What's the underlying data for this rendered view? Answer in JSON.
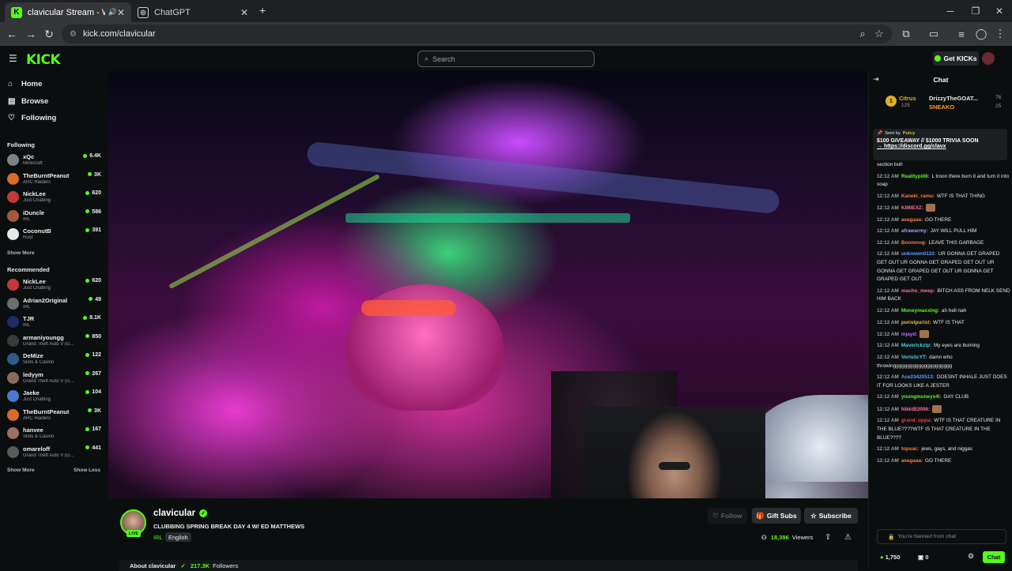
{
  "browser": {
    "tabs": [
      {
        "title": "clavicular Stream - Watch L",
        "active": true
      },
      {
        "title": "ChatGPT",
        "active": false
      }
    ],
    "url": "kick.com/clavicular"
  },
  "header": {
    "logo": "KICK",
    "search_placeholder": "Search",
    "get_kicks_label": "Get KICKs"
  },
  "sidebar": {
    "nav": [
      {
        "label": "Home",
        "icon": "home-icon"
      },
      {
        "label": "Browse",
        "icon": "browse-icon"
      },
      {
        "label": "Following",
        "icon": "heart-icon"
      }
    ],
    "following_title": "Following",
    "following": [
      {
        "name": "xQc",
        "category": "Minecraft",
        "viewers": "6.4K",
        "color": "#7a8188"
      },
      {
        "name": "TheBurntPeanut",
        "category": "ARC Raiders",
        "viewers": "3K",
        "color": "#d96a2a"
      },
      {
        "name": "NickLee",
        "category": "Just Chatting",
        "viewers": "620",
        "color": "#c23a3a"
      },
      {
        "name": "iDuncle",
        "category": "IRL",
        "viewers": "586",
        "color": "#a35a3a"
      },
      {
        "name": "CoconutB",
        "category": "Rust",
        "viewers": "391",
        "color": "#e8e8e8"
      }
    ],
    "show_more_1": "Show More",
    "recommended_title": "Recommended",
    "recommended": [
      {
        "name": "NickLee",
        "category": "Just Chatting",
        "viewers": "620",
        "color": "#c23a3a"
      },
      {
        "name": "Adrian2Original",
        "category": "IRL",
        "viewers": "49",
        "color": "#6a6f74"
      },
      {
        "name": "TJR",
        "category": "IRL",
        "viewers": "8.1K",
        "color": "#1d2a6b"
      },
      {
        "name": "armaniyoungg",
        "category": "Grand Theft Auto V (G...",
        "viewers": "850",
        "color": "#3b3b3b"
      },
      {
        "name": "DeMize",
        "category": "Slots & Casino",
        "viewers": "122",
        "color": "#2d5a8a"
      },
      {
        "name": "ledyym",
        "category": "Grand Theft Auto V (G...",
        "viewers": "267",
        "color": "#8a6a5a"
      },
      {
        "name": "Jaeke",
        "category": "Just Chatting",
        "viewers": "104",
        "color": "#4a7ad0"
      },
      {
        "name": "TheBurntPeanut",
        "category": "ARC Raiders",
        "viewers": "3K",
        "color": "#d96a2a"
      },
      {
        "name": "hanvee",
        "category": "Slots & Casino",
        "viewers": "167",
        "color": "#9a7060"
      },
      {
        "name": "omareloff",
        "category": "Grand Theft Auto V (G...",
        "viewers": "441",
        "color": "#5a5a5a"
      }
    ],
    "show_more_2": "Show More",
    "show_less": "Show Less"
  },
  "stream": {
    "name": "clavicular",
    "live_label": "LIVE",
    "title": "CLUBBING SPRING BREAK DAY 4 W/ ED MATTHEWS",
    "category": "IRL",
    "language": "English",
    "follow_label": "Follow",
    "gift_label": "Gift Subs",
    "subscribe_label": "Subscribe",
    "viewers": "18,396",
    "viewers_label": "Viewers",
    "about_label": "About clavicular",
    "followers": "217.3K",
    "followers_label": "Followers"
  },
  "chat": {
    "title": "Chat",
    "leaderboard": [
      {
        "rank": "1",
        "name": "Citrus",
        "value": "125"
      },
      {
        "name": "DrizzyTheGOAT...",
        "value": "76"
      },
      {
        "name": "SNEAKO",
        "value": "25"
      }
    ],
    "pinned_sender_prefix": "Sent by",
    "pinned_sender": "Pulcy",
    "pinned_text": "$100 GIVEAWAY // $1000 TRIVIA SOON",
    "pinned_link": "https://discord.gg/clavx",
    "messages": [
      {
        "time": "",
        "user": "",
        "color": "#e9ebec",
        "text": "section buh"
      },
      {
        "time": "12:12 AM",
        "user": "Realitypill8:",
        "color": "#53fc18",
        "text": "L troon there burn it and turn it into soap"
      },
      {
        "time": "12:12 AM",
        "user": "Kaneki_ramu:",
        "color": "#ff7a3a",
        "text": "WTF IS THAT THING"
      },
      {
        "time": "12:12 AM",
        "user": "KIMIEXZ:",
        "color": "#ff6b9b",
        "text": ""
      },
      {
        "time": "12:12 AM",
        "user": "aeagaaa:",
        "color": "#ff7a3a",
        "text": "GO THERE"
      },
      {
        "time": "12:12 AM",
        "user": "afrawarmy:",
        "color": "#9aa0ff",
        "text": "JAY WILL PULL HIM"
      },
      {
        "time": "12:12 AM",
        "user": "Boomnog:",
        "color": "#ff7a3a",
        "text": "LEAVE THIS GARBAGE"
      },
      {
        "time": "12:12 AM",
        "user": "unknown0110:",
        "color": "#5aa0ff",
        "text": "UR GONNA GET GRAPED GET OUT UR GONNA GET GRAPED GET OUT UR GONNA GET GRAPED GET OUT UR GONNA GET GRAPED GET OUT"
      },
      {
        "time": "12:12 AM",
        "user": "macho_meep:",
        "color": "#ff6b9b",
        "text": "BITCH ASS FROM NELK SEND HIM BACK"
      },
      {
        "time": "12:12 AM",
        "user": "Moneymaxxing:",
        "color": "#53fc18",
        "text": "ah hell nah"
      },
      {
        "time": "12:12 AM",
        "user": "puristpurist:",
        "color": "#e0c040",
        "text": "WTF IS THAT"
      },
      {
        "time": "12:12 AM",
        "user": "mjayd:",
        "color": "#b070ff",
        "text": ""
      },
      {
        "time": "12:12 AM",
        "user": "Maverickzip:",
        "color": "#4fd0e0",
        "text": "My eyes are burning"
      },
      {
        "time": "12:12 AM",
        "user": "VoristicYT:",
        "color": "#4fd0e0",
        "text": "damn who throwinggggggggggggggggggggg"
      },
      {
        "time": "12:12 AM",
        "user": "Ace23420513:",
        "color": "#5aa0ff",
        "text": "DOESNT INHALE JUST DOES IT FOR LOOKS LIKE A JESTER"
      },
      {
        "time": "12:12 AM",
        "user": "youngmoneyx4l:",
        "color": "#53fc18",
        "text": "GAY CLUB"
      },
      {
        "time": "12:12 AM",
        "user": "NikkiB2006:",
        "color": "#ff6b9b",
        "text": ""
      },
      {
        "time": "12:12 AM",
        "user": "grand_uppa:",
        "color": "#ff3a3a",
        "text": "WTF IS THAT CREATURE IN THE BLUE????WTF IS THAT CREATURE IN THE BLUE????"
      },
      {
        "time": "12:12 AM",
        "user": "topsac:",
        "color": "#ff7a3a",
        "text": "jews, gays, and niggas"
      },
      {
        "time": "12:12 AM",
        "user": "aeagaaa:",
        "color": "#ff7a3a",
        "text": "GO THERE"
      }
    ],
    "input_placeholder": "You're banned from chat",
    "kicks_count": "1,750",
    "gift_count": "0",
    "chat_button": "Chat"
  }
}
